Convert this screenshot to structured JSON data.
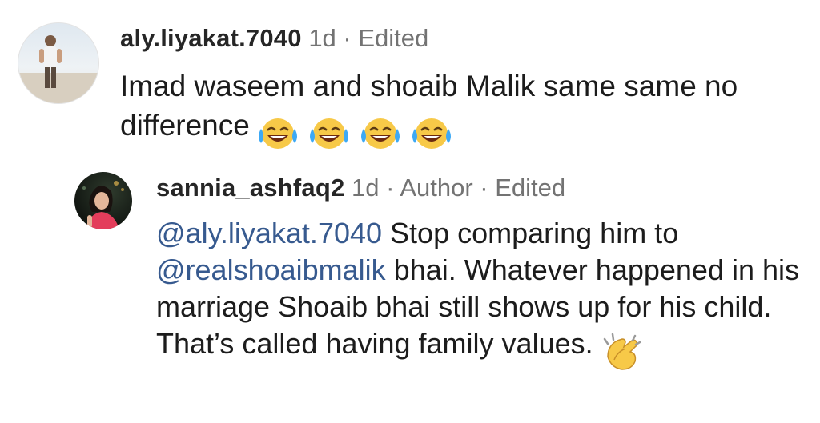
{
  "comments": [
    {
      "username": "aly.liyakat.7040",
      "meta": " 1d · Edited",
      "text": "Imad waseem and shoaib Malik same same no difference",
      "emoji": [
        "face-with-tears-of-joy",
        "face-with-tears-of-joy",
        "face-with-tears-of-joy",
        "face-with-tears-of-joy"
      ]
    },
    {
      "username": "sannia_ashfaq2",
      "meta": " 1d · Author · Edited",
      "mention1": "@aly.liyakat.7040",
      "text1": " Stop comparing him to ",
      "mention2": "@realshoaibmalik",
      "text2": " bhai. Whatever happened in his marriage Shoaib bhai still shows up for his child. That’s called having family values.",
      "emoji": [
        "clapping-hands"
      ]
    }
  ],
  "colors": {
    "mention": "#375a8f",
    "meta": "#737373",
    "text": "#1c1c1c"
  }
}
